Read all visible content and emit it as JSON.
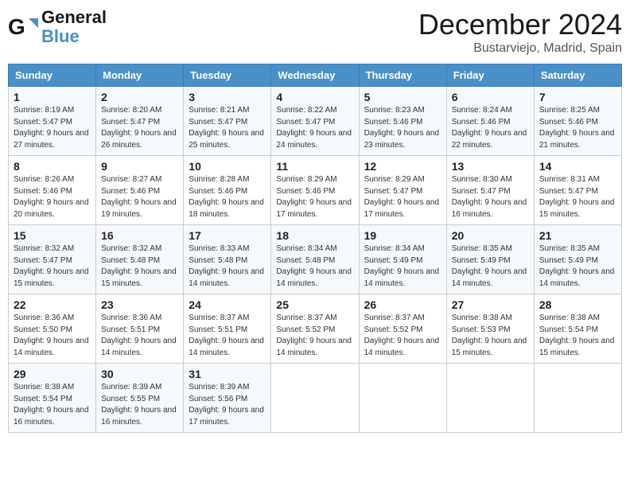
{
  "logo": {
    "line1": "General",
    "line2": "Blue"
  },
  "title": "December 2024",
  "location": "Bustarviejo, Madrid, Spain",
  "days_header": [
    "Sunday",
    "Monday",
    "Tuesday",
    "Wednesday",
    "Thursday",
    "Friday",
    "Saturday"
  ],
  "weeks": [
    [
      {
        "day": "1",
        "sunrise": "8:19 AM",
        "sunset": "5:47 PM",
        "daylight": "9 hours and 27 minutes."
      },
      {
        "day": "2",
        "sunrise": "8:20 AM",
        "sunset": "5:47 PM",
        "daylight": "9 hours and 26 minutes."
      },
      {
        "day": "3",
        "sunrise": "8:21 AM",
        "sunset": "5:47 PM",
        "daylight": "9 hours and 25 minutes."
      },
      {
        "day": "4",
        "sunrise": "8:22 AM",
        "sunset": "5:47 PM",
        "daylight": "9 hours and 24 minutes."
      },
      {
        "day": "5",
        "sunrise": "8:23 AM",
        "sunset": "5:46 PM",
        "daylight": "9 hours and 23 minutes."
      },
      {
        "day": "6",
        "sunrise": "8:24 AM",
        "sunset": "5:46 PM",
        "daylight": "9 hours and 22 minutes."
      },
      {
        "day": "7",
        "sunrise": "8:25 AM",
        "sunset": "5:46 PM",
        "daylight": "9 hours and 21 minutes."
      }
    ],
    [
      {
        "day": "8",
        "sunrise": "8:26 AM",
        "sunset": "5:46 PM",
        "daylight": "9 hours and 20 minutes."
      },
      {
        "day": "9",
        "sunrise": "8:27 AM",
        "sunset": "5:46 PM",
        "daylight": "9 hours and 19 minutes."
      },
      {
        "day": "10",
        "sunrise": "8:28 AM",
        "sunset": "5:46 PM",
        "daylight": "9 hours and 18 minutes."
      },
      {
        "day": "11",
        "sunrise": "8:29 AM",
        "sunset": "5:46 PM",
        "daylight": "9 hours and 17 minutes."
      },
      {
        "day": "12",
        "sunrise": "8:29 AM",
        "sunset": "5:47 PM",
        "daylight": "9 hours and 17 minutes."
      },
      {
        "day": "13",
        "sunrise": "8:30 AM",
        "sunset": "5:47 PM",
        "daylight": "9 hours and 16 minutes."
      },
      {
        "day": "14",
        "sunrise": "8:31 AM",
        "sunset": "5:47 PM",
        "daylight": "9 hours and 15 minutes."
      }
    ],
    [
      {
        "day": "15",
        "sunrise": "8:32 AM",
        "sunset": "5:47 PM",
        "daylight": "9 hours and 15 minutes."
      },
      {
        "day": "16",
        "sunrise": "8:32 AM",
        "sunset": "5:48 PM",
        "daylight": "9 hours and 15 minutes."
      },
      {
        "day": "17",
        "sunrise": "8:33 AM",
        "sunset": "5:48 PM",
        "daylight": "9 hours and 14 minutes."
      },
      {
        "day": "18",
        "sunrise": "8:34 AM",
        "sunset": "5:48 PM",
        "daylight": "9 hours and 14 minutes."
      },
      {
        "day": "19",
        "sunrise": "8:34 AM",
        "sunset": "5:49 PM",
        "daylight": "9 hours and 14 minutes."
      },
      {
        "day": "20",
        "sunrise": "8:35 AM",
        "sunset": "5:49 PM",
        "daylight": "9 hours and 14 minutes."
      },
      {
        "day": "21",
        "sunrise": "8:35 AM",
        "sunset": "5:49 PM",
        "daylight": "9 hours and 14 minutes."
      }
    ],
    [
      {
        "day": "22",
        "sunrise": "8:36 AM",
        "sunset": "5:50 PM",
        "daylight": "9 hours and 14 minutes."
      },
      {
        "day": "23",
        "sunrise": "8:36 AM",
        "sunset": "5:51 PM",
        "daylight": "9 hours and 14 minutes."
      },
      {
        "day": "24",
        "sunrise": "8:37 AM",
        "sunset": "5:51 PM",
        "daylight": "9 hours and 14 minutes."
      },
      {
        "day": "25",
        "sunrise": "8:37 AM",
        "sunset": "5:52 PM",
        "daylight": "9 hours and 14 minutes."
      },
      {
        "day": "26",
        "sunrise": "8:37 AM",
        "sunset": "5:52 PM",
        "daylight": "9 hours and 14 minutes."
      },
      {
        "day": "27",
        "sunrise": "8:38 AM",
        "sunset": "5:53 PM",
        "daylight": "9 hours and 15 minutes."
      },
      {
        "day": "28",
        "sunrise": "8:38 AM",
        "sunset": "5:54 PM",
        "daylight": "9 hours and 15 minutes."
      }
    ],
    [
      {
        "day": "29",
        "sunrise": "8:38 AM",
        "sunset": "5:54 PM",
        "daylight": "9 hours and 16 minutes."
      },
      {
        "day": "30",
        "sunrise": "8:39 AM",
        "sunset": "5:55 PM",
        "daylight": "9 hours and 16 minutes."
      },
      {
        "day": "31",
        "sunrise": "8:39 AM",
        "sunset": "5:56 PM",
        "daylight": "9 hours and 17 minutes."
      },
      null,
      null,
      null,
      null
    ]
  ]
}
